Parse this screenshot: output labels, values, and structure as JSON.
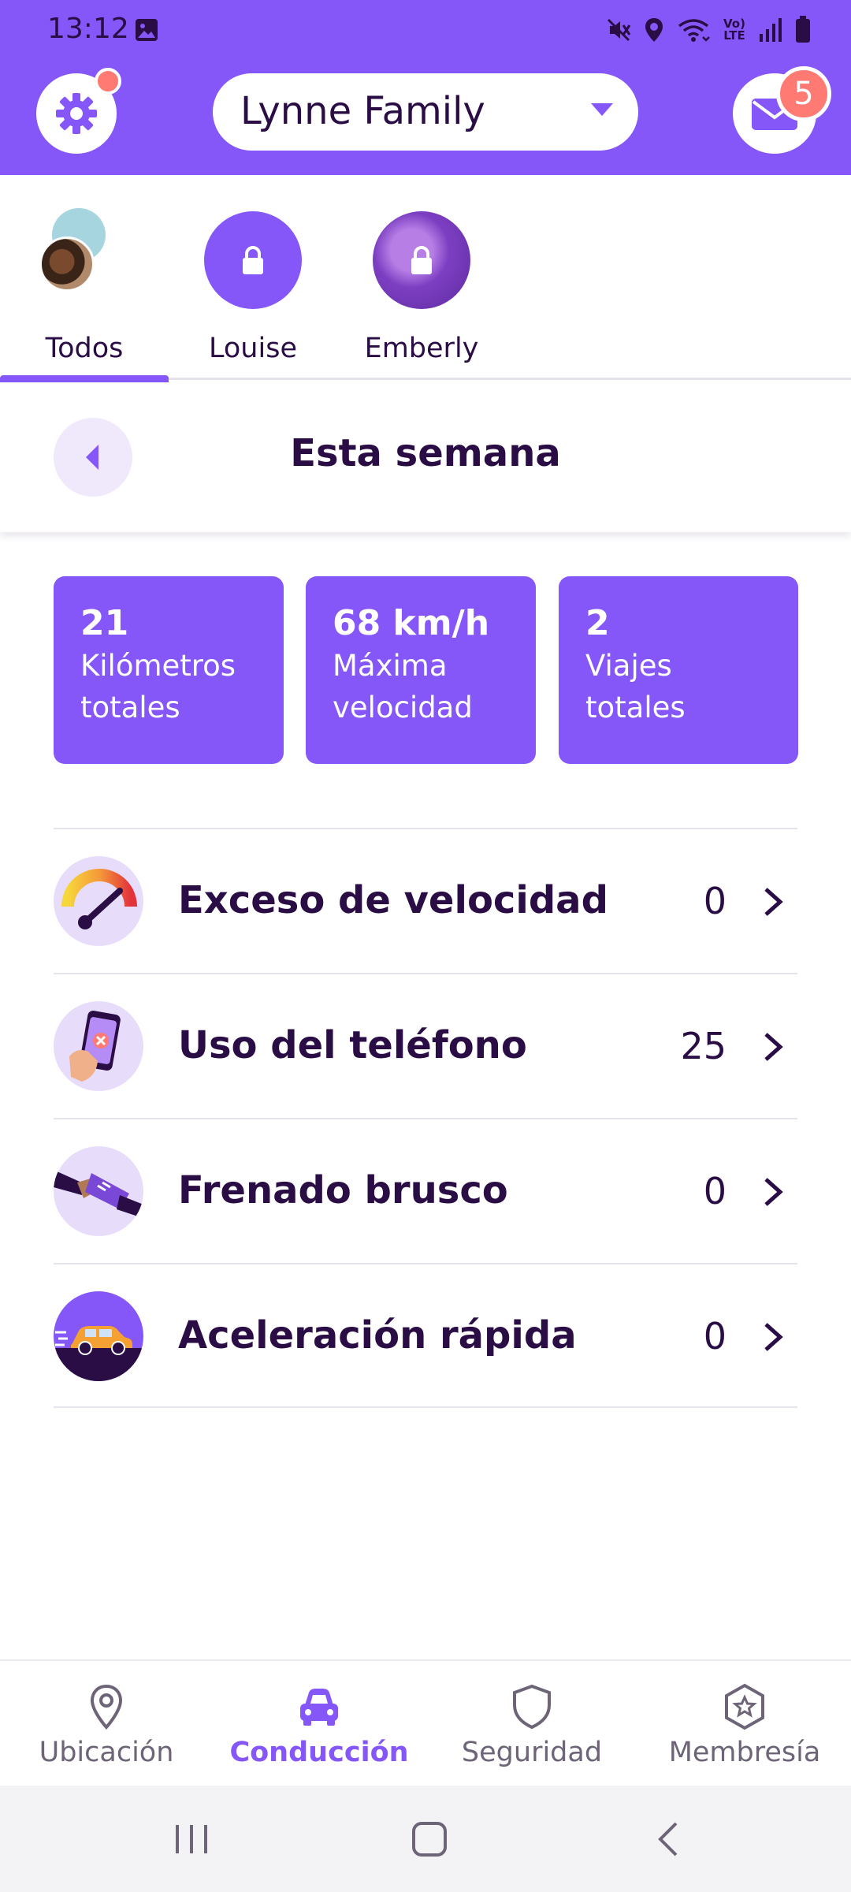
{
  "status_bar": {
    "time": "13:12",
    "icons": [
      "gallery-icon",
      "mute-icon",
      "location-icon",
      "wifi-icon",
      "volte-icon",
      "signal-icon",
      "battery-icon"
    ],
    "volte_text": "Vo) LTE"
  },
  "header": {
    "circle_name": "Lynne Family",
    "inbox_badge": "5",
    "settings_has_dot": true
  },
  "members": [
    {
      "label": "Todos",
      "active": true
    },
    {
      "label": "Louise",
      "locked": true
    },
    {
      "label": "Emberly",
      "locked": true
    }
  ],
  "week": {
    "title": "Esta semana"
  },
  "stats": [
    {
      "value": "21",
      "label": "Kilómetros totales"
    },
    {
      "value": "68 km/h",
      "label": "Máxima velocidad"
    },
    {
      "value": "2",
      "label": "Viajes totales"
    }
  ],
  "events": [
    {
      "label": "Exceso de velocidad",
      "count": "0",
      "icon": "speedometer-icon"
    },
    {
      "label": "Uso del teléfono",
      "count": "25",
      "icon": "phone-usage-icon"
    },
    {
      "label": "Frenado brusco",
      "count": "0",
      "icon": "hard-braking-icon"
    },
    {
      "label": "Aceleración rápida",
      "count": "0",
      "icon": "rapid-acceleration-icon"
    }
  ],
  "bottom_nav": [
    {
      "label": "Ubicación",
      "icon": "location-pin-icon"
    },
    {
      "label": "Conducción",
      "icon": "car-icon",
      "active": true
    },
    {
      "label": "Seguridad",
      "icon": "shield-icon"
    },
    {
      "label": "Membresía",
      "icon": "star-badge-icon"
    }
  ],
  "colors": {
    "brand_purple": "#8557f8",
    "dark_text": "#2a0d45",
    "badge_red": "#ff7a73",
    "light_purple": "#e7ddfb"
  }
}
